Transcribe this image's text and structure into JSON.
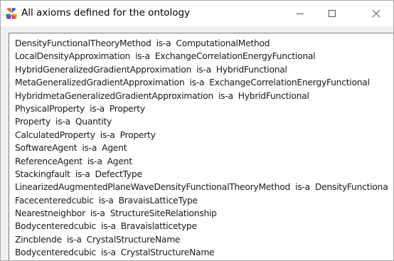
{
  "window": {
    "title": "All axioms defined for the ontology",
    "icon": "ontology-app-icon",
    "controls": {
      "minimize_icon": "minimize-icon",
      "maximize_icon": "maximize-icon",
      "close_icon": "close-icon"
    }
  },
  "axioms": [
    {
      "subject": "DensityFunctionalTheoryMethod",
      "relation": "is-a",
      "object": "ComputationalMethod"
    },
    {
      "subject": "LocalDensityApproximation",
      "relation": "is-a",
      "object": "ExchangeCorrelationEnergyFunctional"
    },
    {
      "subject": "HybridGeneralizedGradientApproximation",
      "relation": "is-a",
      "object": "HybridFunctional"
    },
    {
      "subject": "MetaGeneralizedGradientApproximation",
      "relation": "is-a",
      "object": "ExchangeCorrelationEnergyFunctional"
    },
    {
      "subject": "HybridmetaGeneralizedGradientApproximation",
      "relation": "is-a",
      "object": "HybridFunctional"
    },
    {
      "subject": "PhysicalProperty",
      "relation": "is-a",
      "object": "Property"
    },
    {
      "subject": "Property",
      "relation": "is-a",
      "object": "Quantity"
    },
    {
      "subject": "CalculatedProperty",
      "relation": "is-a",
      "object": "Property"
    },
    {
      "subject": "SoftwareAgent",
      "relation": "is-a",
      "object": "Agent"
    },
    {
      "subject": "ReferenceAgent",
      "relation": "is-a",
      "object": "Agent"
    },
    {
      "subject": "Stackingfault",
      "relation": "is-a",
      "object": "DefectType"
    },
    {
      "subject": "LinearizedAugmentedPlaneWaveDensityFunctionalTheoryMethod",
      "relation": "is-a",
      "object": "DensityFunctiona"
    },
    {
      "subject": "Facecenteredcubic",
      "relation": "is-a",
      "object": "BravaisLatticeType"
    },
    {
      "subject": "Nearestneighbor",
      "relation": "is-a",
      "object": "StructureSiteRelationship"
    },
    {
      "subject": "Bodycenteredcubic",
      "relation": "is-a",
      "object": "Bravaislatticetype"
    },
    {
      "subject": "Zincblende",
      "relation": "is-a",
      "object": "CrystalStructureName"
    },
    {
      "subject": "Bodycenteredcubic",
      "relation": "is-a",
      "object": "CrystalStructureName"
    }
  ],
  "colors": {
    "title_bar": "#ffffff",
    "window_frame": "#f0f0f0",
    "text": "#1a1a1a",
    "controls": "#555555"
  }
}
